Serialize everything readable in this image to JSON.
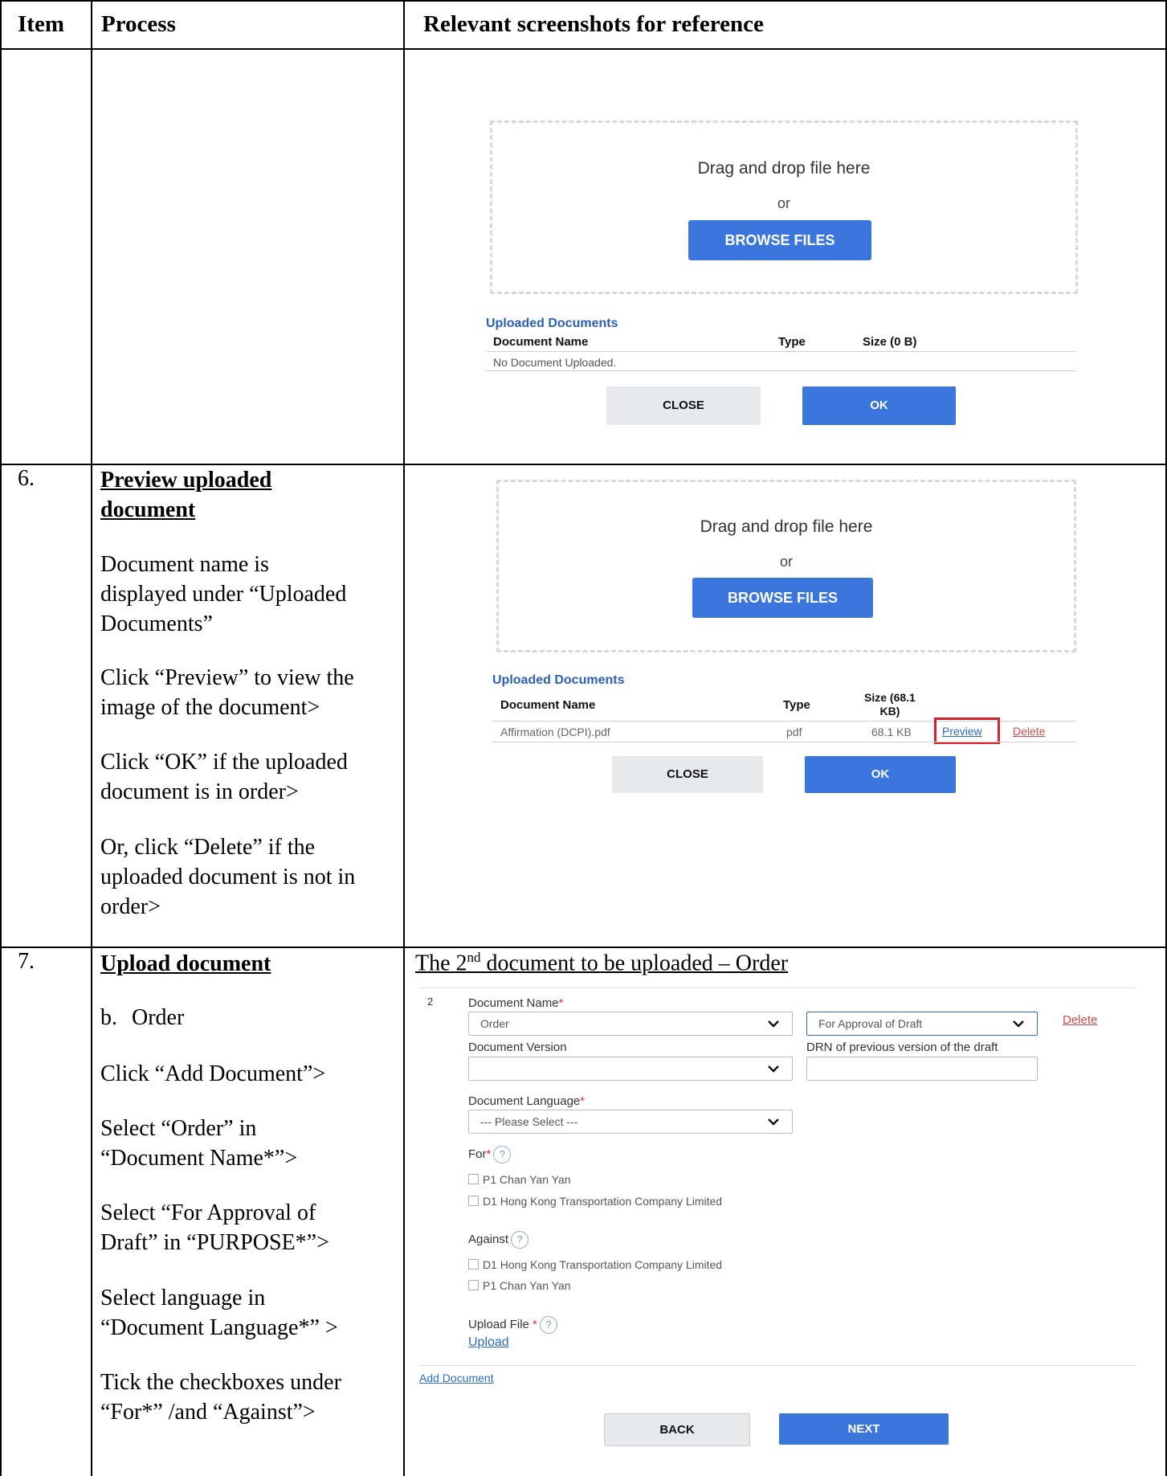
{
  "table": {
    "headers": {
      "item": "Item",
      "process": "Process",
      "screenshots": "Relevant screenshots for reference"
    }
  },
  "dropzone": {
    "drag_text": "Drag and drop file here",
    "or_text": "or",
    "browse_label": "BROWSE FILES"
  },
  "uploaded": {
    "title": "Uploaded Documents",
    "col_name": "Document Name",
    "col_type": "Type",
    "col_size_empty": "Size (0 B)",
    "col_size_line1": "Size (68.1",
    "col_size_line2": "KB)",
    "empty_text": "No Document Uploaded.",
    "row": {
      "name": "Affirmation (DCPI).pdf",
      "type": "pdf",
      "size": "68.1 KB",
      "preview": "Preview",
      "delete": "Delete"
    }
  },
  "dialog_buttons": {
    "close": "CLOSE",
    "ok": "OK"
  },
  "row6": {
    "number": "6.",
    "title_line1": "Preview uploaded",
    "title_line2": "document",
    "p1": [
      "Document name is",
      "displayed under “Uploaded",
      "Documents”"
    ],
    "p2": [
      "Click “Preview” to view the",
      "image of the document>"
    ],
    "p3": [
      "Click “OK” if the uploaded",
      "document is in order>"
    ],
    "p4": [
      "Or, click “Delete” if the",
      "uploaded document is not in",
      "order>"
    ]
  },
  "row7": {
    "number": "7.",
    "title": "Upload document",
    "sub_label": "b.",
    "sub_text": "Order",
    "steps": [
      [
        "Click “Add Document”>"
      ],
      [
        "Select “Order” in",
        "“Document Name*”>"
      ],
      [
        "Select “For Approval of",
        "Draft” in “PURPOSE*”>"
      ],
      [
        "Select language in",
        "“Document Language*” >"
      ],
      [
        "Tick the checkboxes under",
        "“For*” /and “Against”>"
      ]
    ],
    "caption_pre": "The 2",
    "caption_sup": "nd",
    "caption_post": " document to be uploaded – Order"
  },
  "form": {
    "index": "2",
    "doc_name_label": "Document Name",
    "req_mark": "*",
    "doc_name_value": "Order",
    "purpose_value": "For Approval of Draft",
    "delete_link": "Delete",
    "doc_version_label": "Document Version",
    "drn_label": "DRN of previous version of the draft",
    "doc_lang_label": "Document Language",
    "doc_lang_value": "--- Please Select ---",
    "for_label": "For",
    "help_glyph": "?",
    "for_options": [
      "P1 Chan Yan Yan",
      "D1 Hong Kong Transportation Company Limited"
    ],
    "against_label": "Against",
    "against_options": [
      "D1 Hong Kong Transportation Company Limited",
      "P1 Chan Yan Yan"
    ],
    "upload_file_label": "Upload File",
    "upload_link": "Upload",
    "add_document": "Add Document",
    "back": "BACK",
    "next": "NEXT"
  },
  "colors": {
    "primary": "#3a76dc",
    "danger": "#d24b4b",
    "highlight": "#d7202a"
  }
}
